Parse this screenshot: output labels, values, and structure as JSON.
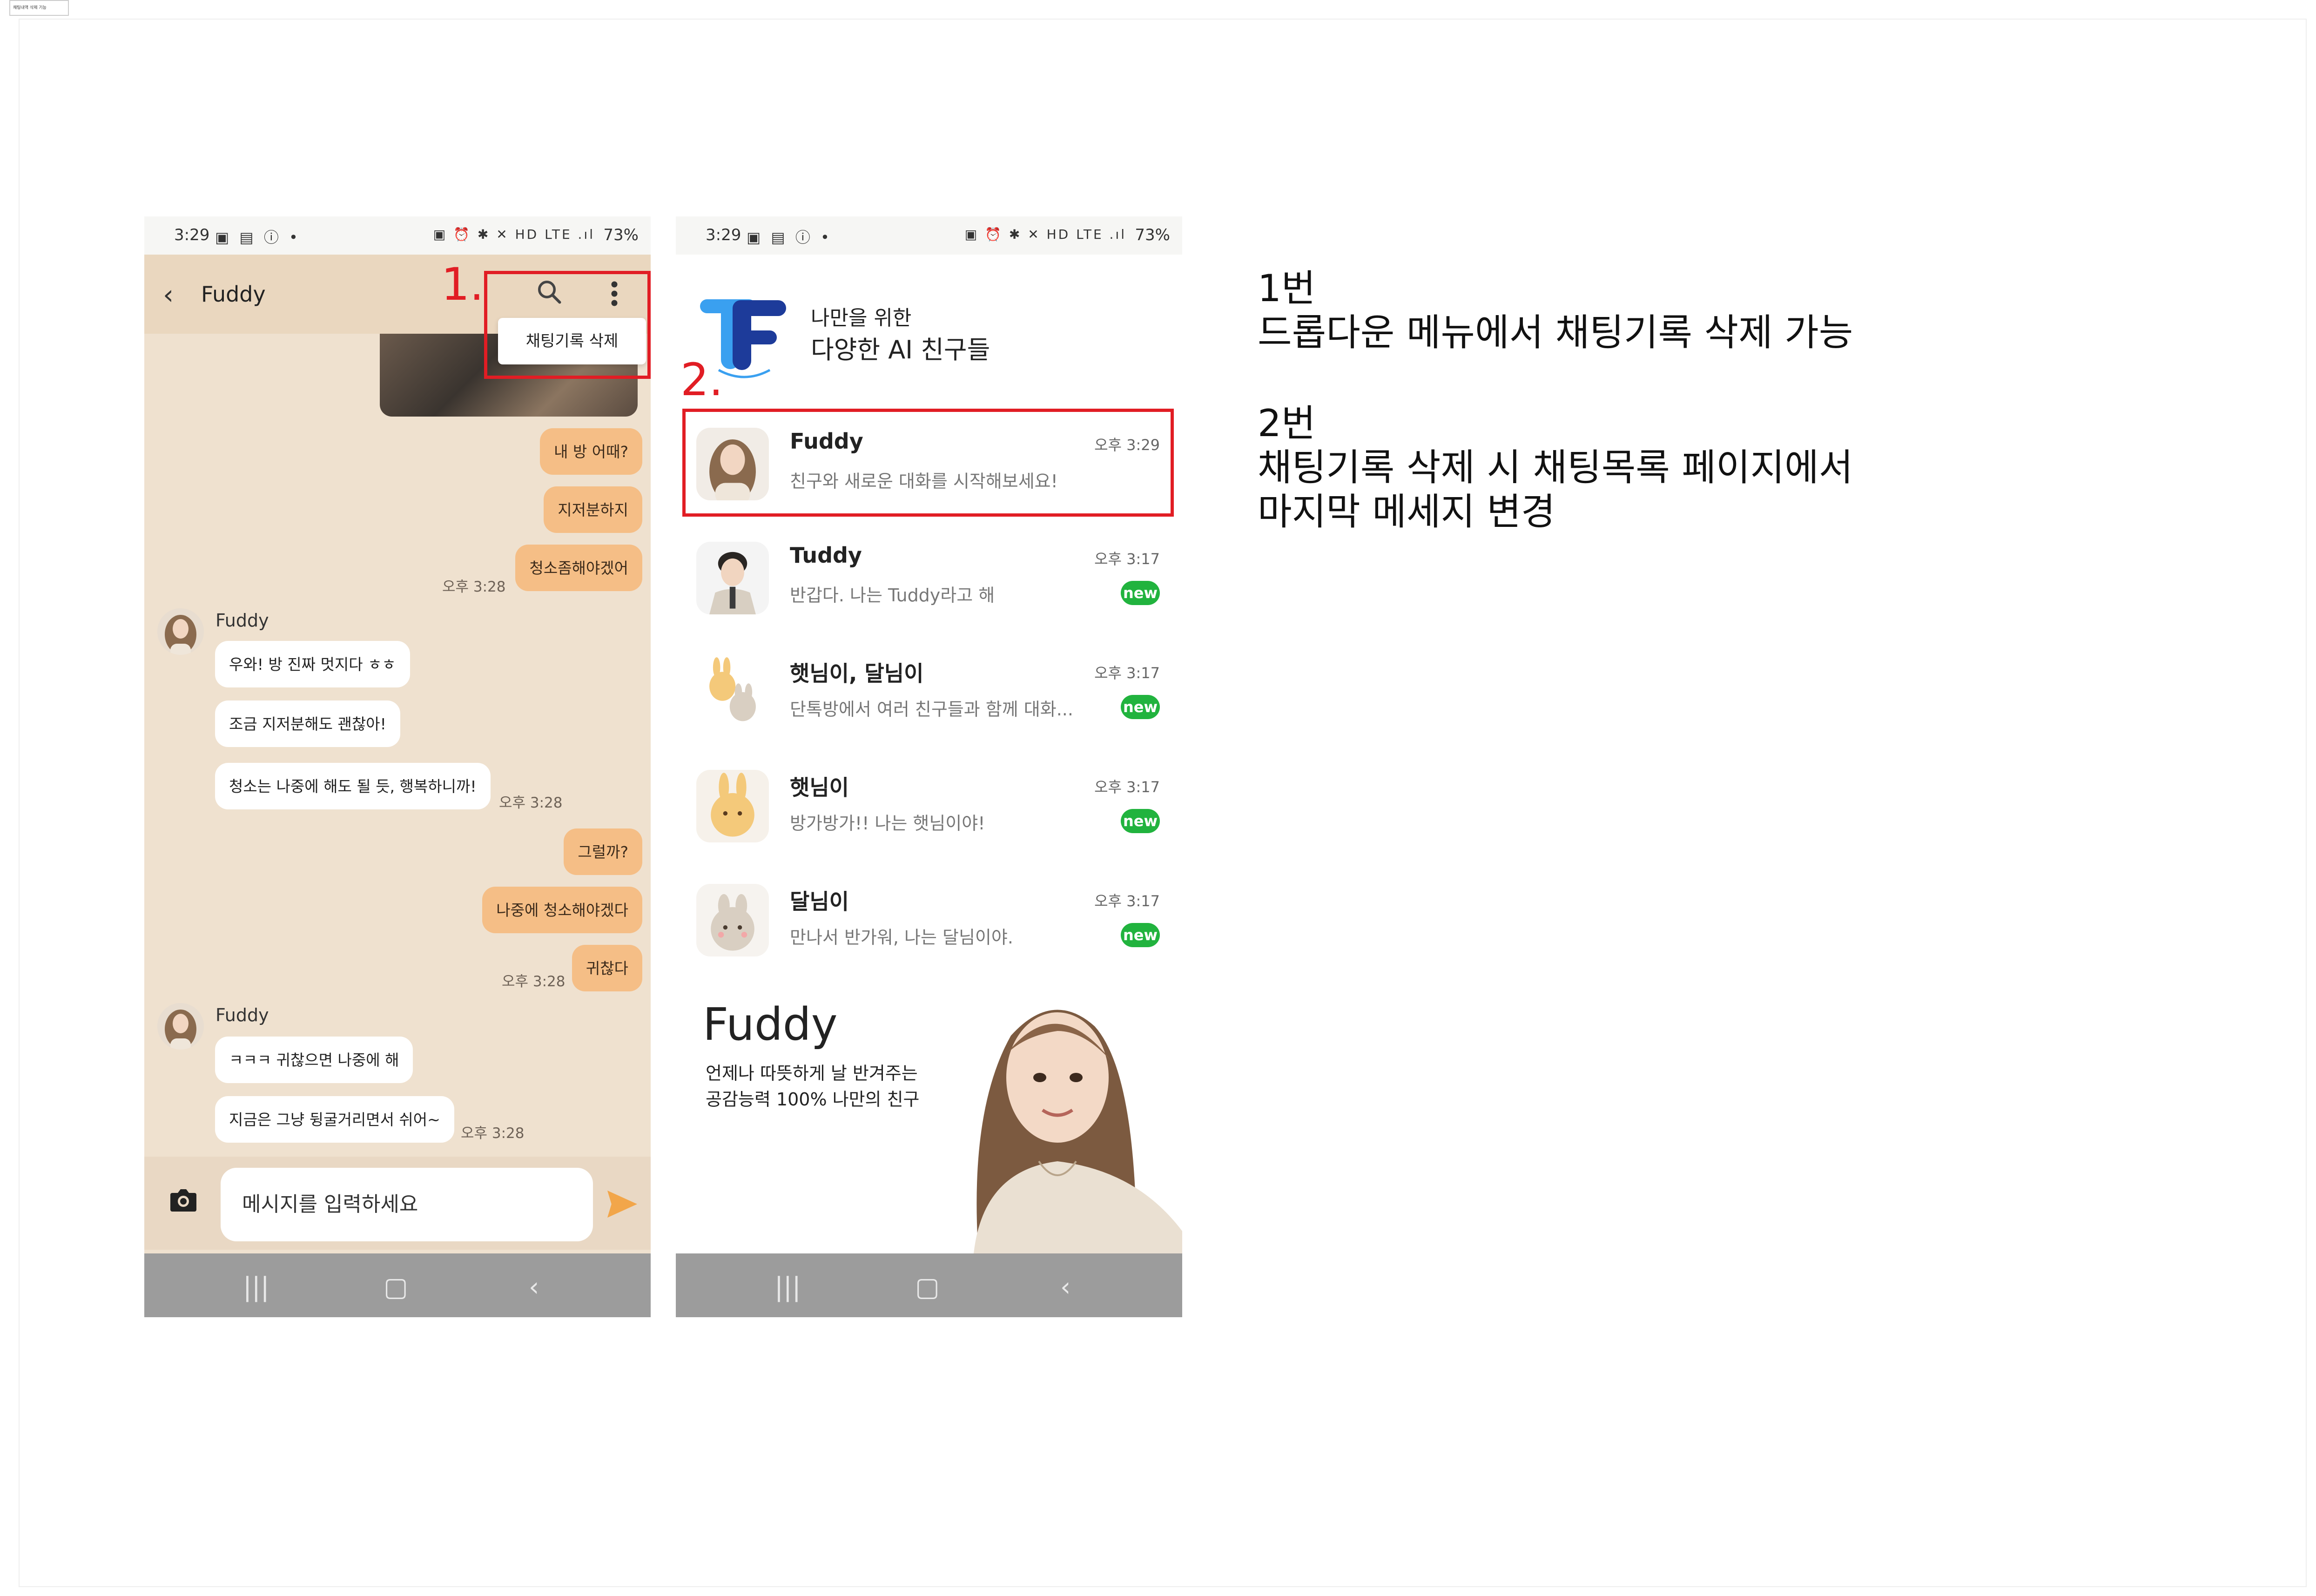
{
  "doc_tag": "채팅내역 삭제 기능",
  "status": {
    "time": "3:29",
    "battery": "73%",
    "left_icons": "▣ ▤ ⓘ •",
    "right_icons": "▣ ⏰ ✱ ✕ HD LTE .ıl"
  },
  "chat": {
    "title": "Fuddy",
    "dropdown_item": "채팅기록 삭제",
    "marker": "1.",
    "messages": [
      {
        "text": "내 방 어때?"
      },
      {
        "text": "지저분하지"
      },
      {
        "text": "청소좀해야겠어"
      },
      {
        "text": "우와! 방 진짜 멋지다 ㅎㅎ"
      },
      {
        "text": "조금 지저분해도 괜찮아!"
      },
      {
        "text": "청소는 나중에 해도 될 듯, 행복하니까!"
      },
      {
        "text": "그럴까?"
      },
      {
        "text": "나중에 청소해야겠다"
      },
      {
        "text": "귀찮다"
      },
      {
        "text": "ㅋㅋㅋ 귀찮으면 나중에 해"
      },
      {
        "text": "지금은 그냥 뒹굴거리면서 쉬어~"
      }
    ],
    "timestamps": [
      "오후 3:28",
      "오후 3:28",
      "오후 3:28",
      "오후 3:28"
    ],
    "sender": "Fuddy",
    "input_placeholder": "메시지를 입력하세요"
  },
  "list": {
    "tagline_line1": "나만을 위한",
    "tagline_line2": "다양한 AI 친구들",
    "marker": "2.",
    "new_label": "new",
    "items": [
      {
        "name": "Fuddy",
        "time": "오후 3:29",
        "message": "친구와 새로운 대화를 시작해보세요!",
        "new": false
      },
      {
        "name": "Tuddy",
        "time": "오후 3:17",
        "message": "반갑다. 나는 Tuddy라고 해",
        "new": true
      },
      {
        "name": "햇님이, 달님이",
        "time": "오후 3:17",
        "message": "단톡방에서 여러 친구들과 함께 대화...",
        "new": true
      },
      {
        "name": "햇님이",
        "time": "오후 3:17",
        "message": "방가방가!! 나는 햇님이야!",
        "new": true
      },
      {
        "name": "달님이",
        "time": "오후 3:17",
        "message": "만나서 반가워, 나는 달님이야.",
        "new": true
      }
    ],
    "promo_title": "Fuddy",
    "promo_line1": "언제나 따뜻하게 날 반겨주는",
    "promo_line2": "공감능력 100% 나만의 친구"
  },
  "annotation": {
    "n1_title": "1번",
    "n1_desc": "드롭다운 메뉴에서 채팅기록 삭제 가능",
    "n2_title": "2번",
    "n2_desc1": "채팅기록 삭제 시 채팅목록 페이지에서",
    "n2_desc2": "마지막 메세지 변경"
  },
  "colors": {
    "chat_bg": "#efe1cf",
    "my_bubble": "#f5be86",
    "highlight": "#e11d24",
    "new_badge": "#21b33e"
  }
}
